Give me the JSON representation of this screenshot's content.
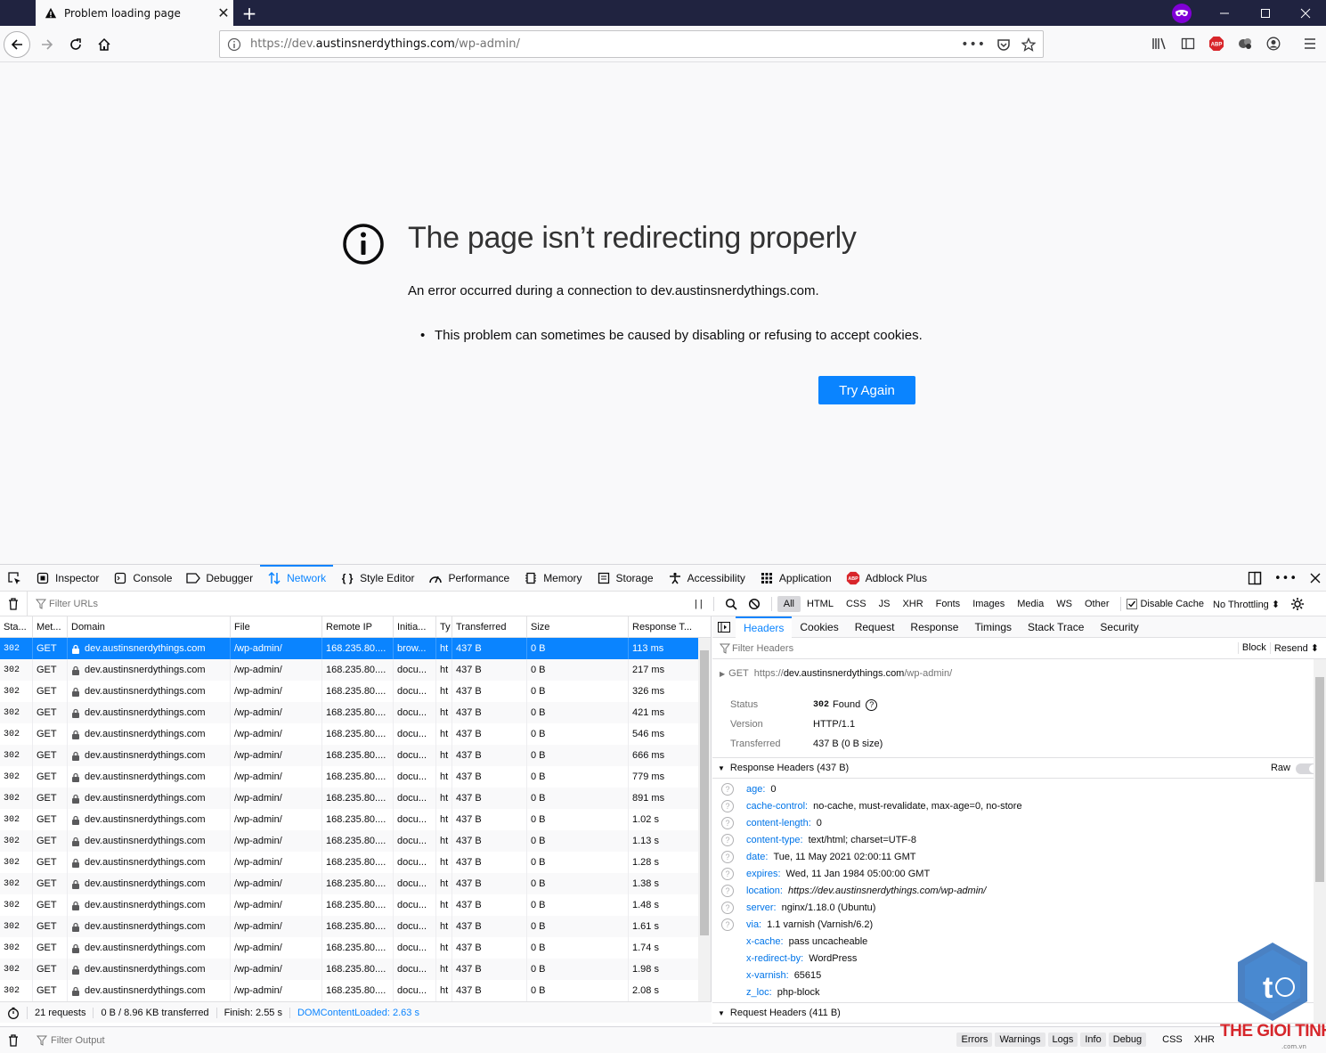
{
  "browser": {
    "tab_title": "Problem loading page",
    "url_prefix": "https://dev.",
    "url_domain": "austinsnerdythings.com",
    "url_path": "/wp-admin/"
  },
  "error": {
    "title": "The page isn’t redirecting properly",
    "description": "An error occurred during a connection to dev.austinsnerdythings.com.",
    "bullet": "This problem can sometimes be caused by disabling or refusing to accept cookies.",
    "button": "Try Again"
  },
  "devtools": {
    "tabs": [
      "Inspector",
      "Console",
      "Debugger",
      "Network",
      "Style Editor",
      "Performance",
      "Memory",
      "Storage",
      "Accessibility",
      "Application",
      "Adblock Plus"
    ],
    "selected_tab": "Network",
    "filter_urls_placeholder": "Filter URLs",
    "type_filters": [
      "All",
      "HTML",
      "CSS",
      "JS",
      "XHR",
      "Fonts",
      "Images",
      "Media",
      "WS",
      "Other"
    ],
    "disable_cache": "Disable Cache",
    "throttling": "No Throttling ⬍",
    "columns": [
      "Sta...",
      "Met...",
      "Domain",
      "File",
      "Remote IP",
      "Initia...",
      "Ty",
      "Transferred",
      "Size",
      "Response T..."
    ],
    "requests": [
      {
        "status": "302",
        "method": "GET",
        "domain": "dev.austinsnerdythings.com",
        "file": "/wp-admin/",
        "ip": "168.235.80....",
        "init": "brow...",
        "type": "ht",
        "transferred": "437 B",
        "size": "0 B",
        "time": "113 ms"
      },
      {
        "status": "302",
        "method": "GET",
        "domain": "dev.austinsnerdythings.com",
        "file": "/wp-admin/",
        "ip": "168.235.80....",
        "init": "docu...",
        "type": "ht",
        "transferred": "437 B",
        "size": "0 B",
        "time": "217 ms"
      },
      {
        "status": "302",
        "method": "GET",
        "domain": "dev.austinsnerdythings.com",
        "file": "/wp-admin/",
        "ip": "168.235.80....",
        "init": "docu...",
        "type": "ht",
        "transferred": "437 B",
        "size": "0 B",
        "time": "326 ms"
      },
      {
        "status": "302",
        "method": "GET",
        "domain": "dev.austinsnerdythings.com",
        "file": "/wp-admin/",
        "ip": "168.235.80....",
        "init": "docu...",
        "type": "ht",
        "transferred": "437 B",
        "size": "0 B",
        "time": "421 ms"
      },
      {
        "status": "302",
        "method": "GET",
        "domain": "dev.austinsnerdythings.com",
        "file": "/wp-admin/",
        "ip": "168.235.80....",
        "init": "docu...",
        "type": "ht",
        "transferred": "437 B",
        "size": "0 B",
        "time": "546 ms"
      },
      {
        "status": "302",
        "method": "GET",
        "domain": "dev.austinsnerdythings.com",
        "file": "/wp-admin/",
        "ip": "168.235.80....",
        "init": "docu...",
        "type": "ht",
        "transferred": "437 B",
        "size": "0 B",
        "time": "666 ms"
      },
      {
        "status": "302",
        "method": "GET",
        "domain": "dev.austinsnerdythings.com",
        "file": "/wp-admin/",
        "ip": "168.235.80....",
        "init": "docu...",
        "type": "ht",
        "transferred": "437 B",
        "size": "0 B",
        "time": "779 ms"
      },
      {
        "status": "302",
        "method": "GET",
        "domain": "dev.austinsnerdythings.com",
        "file": "/wp-admin/",
        "ip": "168.235.80....",
        "init": "docu...",
        "type": "ht",
        "transferred": "437 B",
        "size": "0 B",
        "time": "891 ms"
      },
      {
        "status": "302",
        "method": "GET",
        "domain": "dev.austinsnerdythings.com",
        "file": "/wp-admin/",
        "ip": "168.235.80....",
        "init": "docu...",
        "type": "ht",
        "transferred": "437 B",
        "size": "0 B",
        "time": "1.02 s"
      },
      {
        "status": "302",
        "method": "GET",
        "domain": "dev.austinsnerdythings.com",
        "file": "/wp-admin/",
        "ip": "168.235.80....",
        "init": "docu...",
        "type": "ht",
        "transferred": "437 B",
        "size": "0 B",
        "time": "1.13 s"
      },
      {
        "status": "302",
        "method": "GET",
        "domain": "dev.austinsnerdythings.com",
        "file": "/wp-admin/",
        "ip": "168.235.80....",
        "init": "docu...",
        "type": "ht",
        "transferred": "437 B",
        "size": "0 B",
        "time": "1.28 s"
      },
      {
        "status": "302",
        "method": "GET",
        "domain": "dev.austinsnerdythings.com",
        "file": "/wp-admin/",
        "ip": "168.235.80....",
        "init": "docu...",
        "type": "ht",
        "transferred": "437 B",
        "size": "0 B",
        "time": "1.38 s"
      },
      {
        "status": "302",
        "method": "GET",
        "domain": "dev.austinsnerdythings.com",
        "file": "/wp-admin/",
        "ip": "168.235.80....",
        "init": "docu...",
        "type": "ht",
        "transferred": "437 B",
        "size": "0 B",
        "time": "1.48 s"
      },
      {
        "status": "302",
        "method": "GET",
        "domain": "dev.austinsnerdythings.com",
        "file": "/wp-admin/",
        "ip": "168.235.80....",
        "init": "docu...",
        "type": "ht",
        "transferred": "437 B",
        "size": "0 B",
        "time": "1.61 s"
      },
      {
        "status": "302",
        "method": "GET",
        "domain": "dev.austinsnerdythings.com",
        "file": "/wp-admin/",
        "ip": "168.235.80....",
        "init": "docu...",
        "type": "ht",
        "transferred": "437 B",
        "size": "0 B",
        "time": "1.74 s"
      },
      {
        "status": "302",
        "method": "GET",
        "domain": "dev.austinsnerdythings.com",
        "file": "/wp-admin/",
        "ip": "168.235.80....",
        "init": "docu...",
        "type": "ht",
        "transferred": "437 B",
        "size": "0 B",
        "time": "1.98 s"
      },
      {
        "status": "302",
        "method": "GET",
        "domain": "dev.austinsnerdythings.com",
        "file": "/wp-admin/",
        "ip": "168.235.80....",
        "init": "docu...",
        "type": "ht",
        "transferred": "437 B",
        "size": "0 B",
        "time": "2.08 s"
      }
    ],
    "summary": {
      "requests": "21 requests",
      "transferred": "0 B / 8.96 KB transferred",
      "finish": "Finish: 2.55 s",
      "dom_loaded": "DOMContentLoaded: 2.63 s"
    },
    "detail_tabs": [
      "Headers",
      "Cookies",
      "Request",
      "Response",
      "Timings",
      "Stack Trace",
      "Security"
    ],
    "filter_headers_placeholder": "Filter Headers",
    "block_label": "Block",
    "resend_label": "Resend ⬍",
    "request_method": "GET",
    "request_url_prefix": "https://",
    "request_url_domain": "dev.austinsnerdythings.com",
    "request_url_path": "/wp-admin/",
    "status_label": "Status",
    "status_code": "302",
    "status_text": "Found",
    "version_label": "Version",
    "version_value": "HTTP/1.1",
    "transferred_label": "Transferred",
    "transferred_value": "437 B (0 B size)",
    "response_headers_title": "Response Headers (437 B)",
    "raw_label": "Raw",
    "response_headers": [
      {
        "name": "age:",
        "value": "0",
        "help": true
      },
      {
        "name": "cache-control:",
        "value": "no-cache, must-revalidate, max-age=0, no-store",
        "help": true
      },
      {
        "name": "content-length:",
        "value": "0",
        "help": true
      },
      {
        "name": "content-type:",
        "value": "text/html; charset=UTF-8",
        "help": true
      },
      {
        "name": "date:",
        "value": "Tue, 11 May 2021 02:00:11 GMT",
        "help": true
      },
      {
        "name": "expires:",
        "value": "Wed, 11 Jan 1984 05:00:00 GMT",
        "help": true
      },
      {
        "name": "location:",
        "value": "https://dev.austinsnerdythings.com/wp-admin/",
        "help": true,
        "italic": true
      },
      {
        "name": "server:",
        "value": "nginx/1.18.0 (Ubuntu)",
        "help": true
      },
      {
        "name": "via:",
        "value": "1.1 varnish (Varnish/6.2)",
        "help": true
      },
      {
        "name": "x-cache:",
        "value": "pass uncacheable",
        "help": false
      },
      {
        "name": "x-redirect-by:",
        "value": "WordPress",
        "help": false
      },
      {
        "name": "x-varnish:",
        "value": "65615",
        "help": false
      },
      {
        "name": "z_loc:",
        "value": "php-block",
        "help": false
      }
    ],
    "request_headers_title": "Request Headers (411 B)",
    "console": {
      "filter_placeholder": "Filter Output",
      "levels": [
        "Errors",
        "Warnings",
        "Logs",
        "Info",
        "Debug"
      ],
      "extra": [
        "CSS",
        "XHR"
      ]
    }
  },
  "watermark": {
    "brand_part1": "THE GIOI ",
    "brand_part2": "TINHOC",
    "domain": ".com.vn"
  },
  "colors": {
    "accent": "#0a84ff",
    "tabstrip": "#202340",
    "private": "#8000d7",
    "abp": "#d8252a"
  }
}
